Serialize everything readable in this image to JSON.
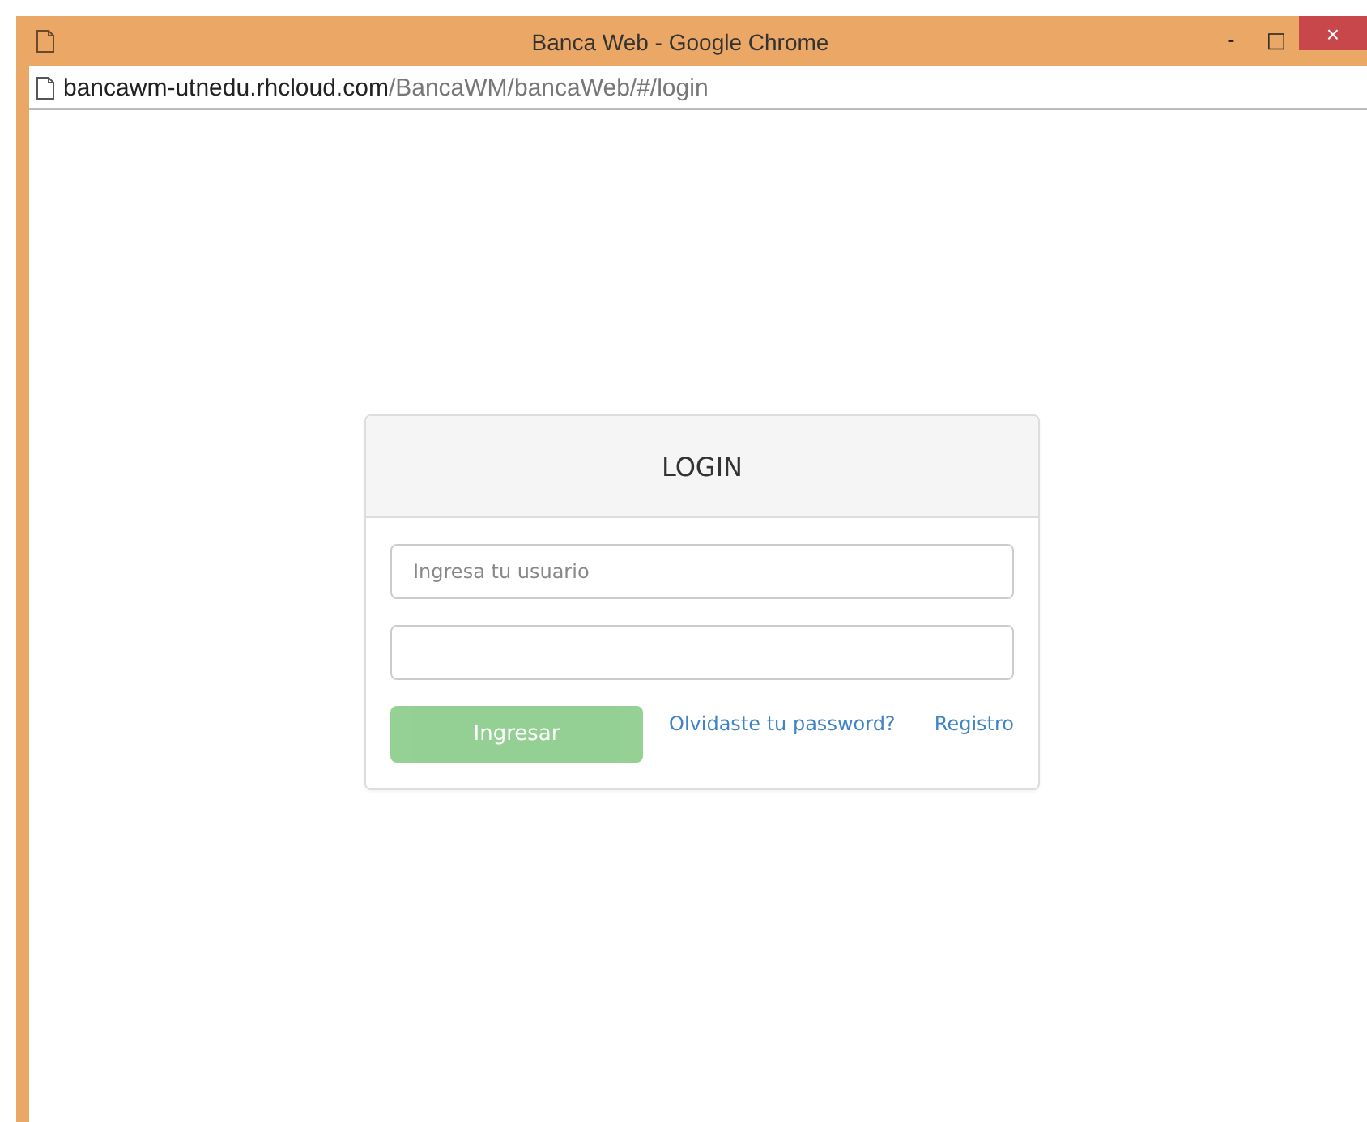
{
  "window": {
    "title": "Banca Web - Google Chrome",
    "minimize": "-",
    "maximize": "□",
    "close": "×"
  },
  "address_bar": {
    "host": "bancawm-utnedu.rhcloud.com",
    "path": "/BancaWM/bancaWeb/#/login"
  },
  "login": {
    "title": "LOGIN",
    "username": {
      "placeholder": "Ingresa tu usuario"
    },
    "password_field": true,
    "submit": {
      "label": "Ingresar",
      "disabled": true
    },
    "links": [
      "Olvidaste tu password?",
      "Registro"
    ]
  }
}
